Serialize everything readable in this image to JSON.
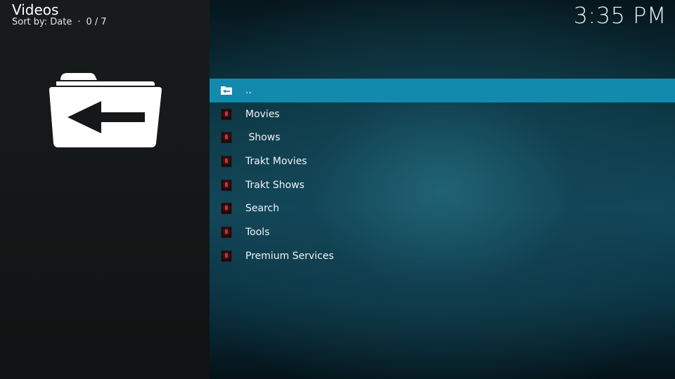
{
  "header": {
    "title": "Videos",
    "sort_label": "Sort by: Date",
    "separator": "·",
    "position": "0 / 7"
  },
  "clock": "3:35 PM",
  "big_icon": {
    "icon": "folder-back-icon"
  },
  "list": {
    "items": [
      {
        "label": "..",
        "icon": "folder-up-icon",
        "selected": true
      },
      {
        "label": "Movies",
        "icon": "addon-thumbnail",
        "selected": false
      },
      {
        "label": " Shows",
        "icon": "addon-thumbnail",
        "selected": false
      },
      {
        "label": "Trakt Movies",
        "icon": "addon-thumbnail",
        "selected": false
      },
      {
        "label": "Trakt Shows",
        "icon": "addon-thumbnail",
        "selected": false
      },
      {
        "label": "Search",
        "icon": "addon-thumbnail",
        "selected": false
      },
      {
        "label": "Tools",
        "icon": "addon-thumbnail",
        "selected": false
      },
      {
        "label": "Premium Services",
        "icon": "addon-thumbnail",
        "selected": false
      }
    ]
  },
  "colors": {
    "selection": "#128aad",
    "left_panel": "#161819",
    "background": "#0d3a48"
  }
}
